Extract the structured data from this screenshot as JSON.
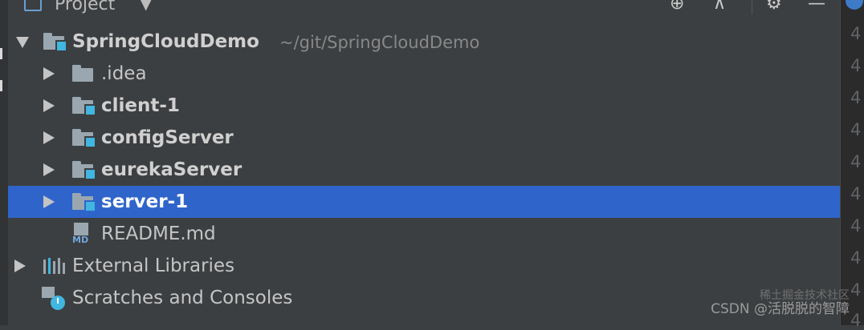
{
  "header": {
    "title": "Project",
    "icons": [
      "project-view-icon",
      "chevron-down-icon",
      "locate-icon",
      "collapse-icon",
      "gear-icon",
      "hide-icon"
    ]
  },
  "tree": {
    "root": {
      "name": "SpringCloudDemo",
      "path": "~/git/SpringCloudDemo"
    },
    "children": [
      {
        "name": ".idea"
      },
      {
        "name": "client-1"
      },
      {
        "name": "configServer"
      },
      {
        "name": "eurekaServer"
      },
      {
        "name": "server-1"
      },
      {
        "name": "README.md"
      }
    ],
    "external_libraries": "External Libraries",
    "scratches": "Scratches and Consoles",
    "selected": "server-1"
  },
  "gutter": {
    "digits": [
      "4",
      "4",
      "4",
      "4",
      "4",
      "4",
      "4",
      "4",
      "4",
      "4"
    ]
  },
  "watermark": {
    "text": "CSDN @活脱脱的智障",
    "faint": "稀土掘金技术社区"
  },
  "colors": {
    "selection": "#2f65ca",
    "module_badge": "#40b6e0",
    "background": "#3c3f41"
  }
}
